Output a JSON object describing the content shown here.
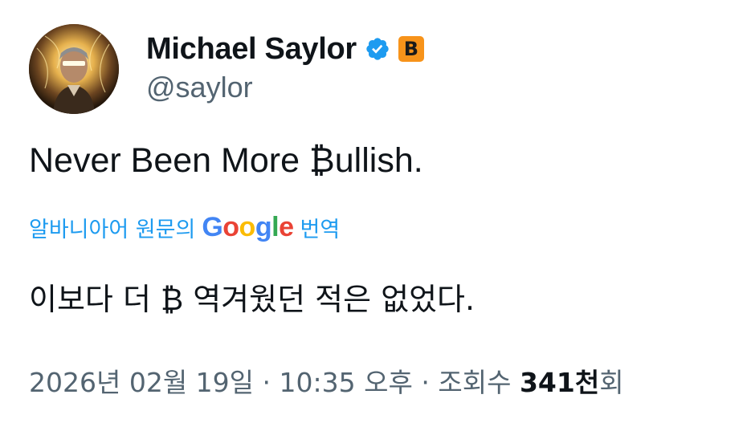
{
  "author": {
    "display_name": "Michael Saylor",
    "handle": "@saylor",
    "verified": true,
    "badge_icon": "bitcoin-badge-icon",
    "badge_symbol": "B",
    "badge_color": "#f7931a"
  },
  "tweet": {
    "text": "Never Been More ₿ullish."
  },
  "translation": {
    "label": "알바니아어 원문의",
    "provider": "Google",
    "suffix": "번역",
    "text": "이보다 더 ₿ 역겨웠던 적은 없었다."
  },
  "meta": {
    "date": "2026년 02월 19일",
    "separator": "·",
    "time": "10:35 오후",
    "views_label": "조회수",
    "views_count": "341천",
    "views_suffix": "회"
  },
  "colors": {
    "link": "#1d9bf0",
    "text": "#0f1419",
    "secondary": "#536471"
  }
}
